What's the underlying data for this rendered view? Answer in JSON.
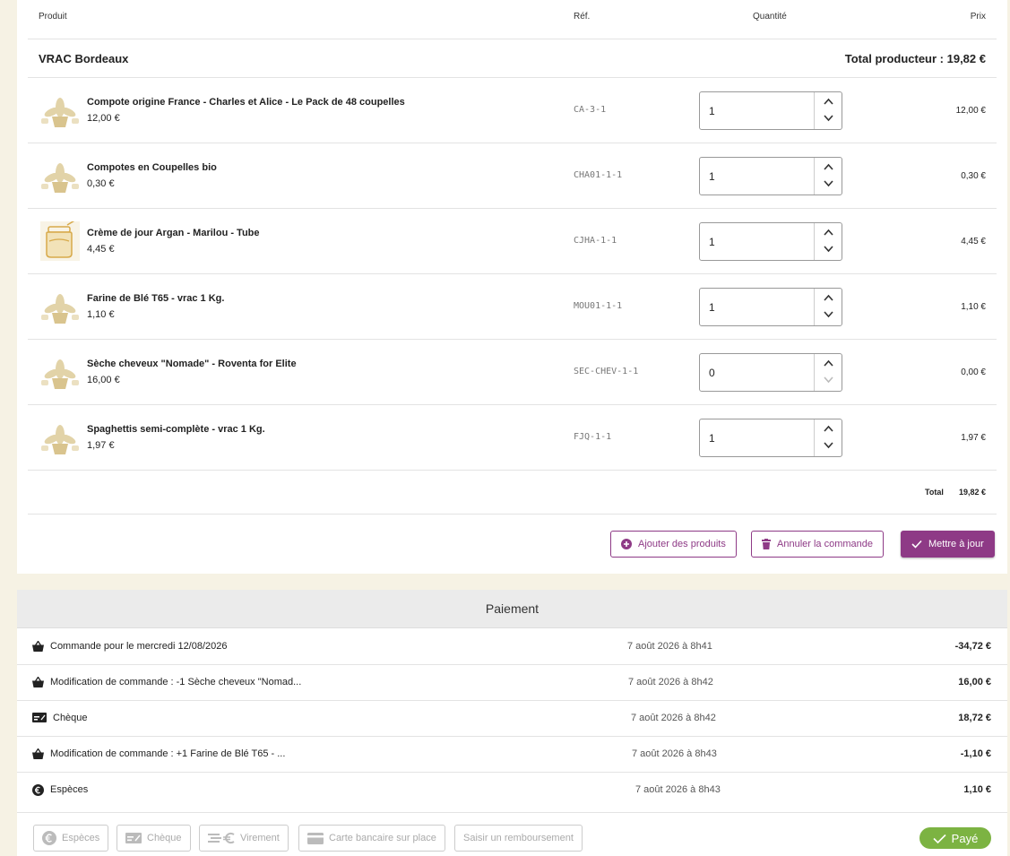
{
  "table": {
    "headers": {
      "product": "Produit",
      "ref": "Réf.",
      "quantity": "Quantité",
      "price": "Prix"
    },
    "producer": {
      "name": "VRAC Bordeaux",
      "total": "Total producteur : 19,82 €"
    },
    "rows": [
      {
        "name": "Compote origine France - Charles et Alice - Le Pack de 48 coupelles",
        "unit_price": "12,00 €",
        "ref": "CA-3-1",
        "qty": "1",
        "line_price": "12,00 €",
        "thumb_icon": "plant-pot-icon"
      },
      {
        "name": "Compotes en Coupelles bio",
        "unit_price": "0,30 €",
        "ref": "CHA01-1-1",
        "qty": "1",
        "line_price": "0,30 €",
        "thumb_icon": "plant-pot-icon"
      },
      {
        "name": "Crème de jour Argan - Marilou - Tube",
        "unit_price": "4,45 €",
        "ref": "CJHA-1-1",
        "qty": "1",
        "line_price": "4,45 €",
        "thumb_icon": "jar-icon"
      },
      {
        "name": "Farine de Blé T65 - vrac 1 Kg.",
        "unit_price": "1,10 €",
        "ref": "MOU01-1-1",
        "qty": "1",
        "line_price": "1,10 €",
        "thumb_icon": "plant-pot-icon"
      },
      {
        "name": "Sèche cheveux \"Nomade\" - Roventa for Elite",
        "unit_price": "16,00 €",
        "ref": "SEC-CHEV-1-1",
        "qty": "0",
        "line_price": "0,00 €",
        "thumb_icon": "plant-pot-icon"
      },
      {
        "name": "Spaghettis semi-complète - vrac 1 Kg.",
        "unit_price": "1,97 €",
        "ref": "FJQ-1-1",
        "qty": "1",
        "line_price": "1,97 €",
        "thumb_icon": "plant-pot-icon"
      }
    ],
    "total_label": "Total",
    "total_value": "19,82 €"
  },
  "actions": {
    "add_products": "Ajouter des produits",
    "cancel_order": "Annuler la commande",
    "update": "Mettre à jour"
  },
  "payment": {
    "title": "Paiement",
    "entries": [
      {
        "icon": "basket-icon",
        "label": "Commande pour le mercredi 12/08/2026",
        "date": "7 août 2026 à 8h41",
        "amount": "-34,72 €"
      },
      {
        "icon": "basket-icon",
        "label": "Modification de commande : -1 Sèche cheveux \"Nomad...",
        "date": "7 août 2026 à 8h42",
        "amount": "16,00 €"
      },
      {
        "icon": "cheque-icon",
        "label": "Chèque",
        "date": "7 août 2026 à 8h42",
        "amount": "18,72 €"
      },
      {
        "icon": "basket-icon",
        "label": "Modification de commande : +1 Farine de Blé T65 - ...",
        "date": "7 août 2026 à 8h43",
        "amount": "-1,10 €"
      },
      {
        "icon": "euro-coin-icon",
        "label": "Espèces",
        "date": "7 août 2026 à 8h43",
        "amount": "1,10 €"
      }
    ],
    "methods": {
      "cash": "Espèces",
      "cheque": "Chèque",
      "transfer": "Virement",
      "card": "Carte bancaire sur place",
      "refund": "Saisir un remboursement"
    },
    "status": "Payé"
  },
  "colors": {
    "accent": "#8e3a86",
    "paid": "#7cb342",
    "page_bg": "#f6f2e4"
  }
}
